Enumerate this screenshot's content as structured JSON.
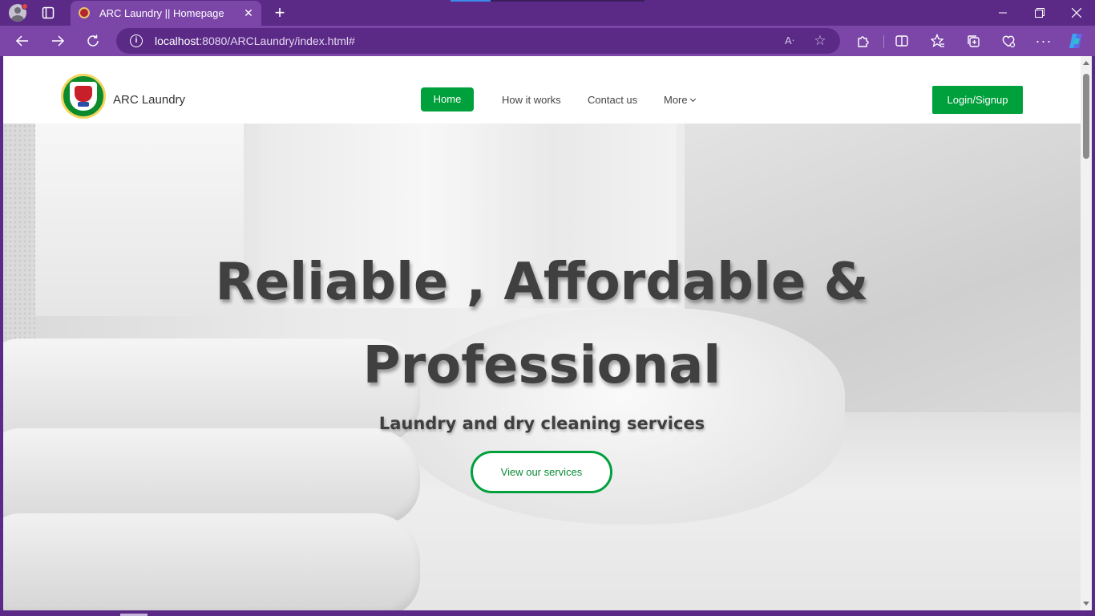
{
  "browser": {
    "tab_title": "ARC Laundry || Homepage",
    "url_host": "localhost",
    "url_path": ":8080/ARCLaundry/index.html#"
  },
  "site": {
    "brand": "ARC Laundry",
    "nav": {
      "home": "Home",
      "how": "How it works",
      "contact": "Contact us",
      "more": "More"
    },
    "login": "Login/Signup"
  },
  "hero": {
    "title_line1": "Reliable , Affordable &",
    "title_line2": "Professional",
    "subtitle": "Laundry and dry cleaning services",
    "cta": "View our services"
  },
  "colors": {
    "browser_frame": "#5b2a86",
    "browser_toolbar": "#7b46a8",
    "accent_green": "#00a03c"
  },
  "icons": [
    "profile-icon",
    "tab-actions-icon",
    "new-tab-icon",
    "back-icon",
    "forward-icon",
    "reload-icon",
    "info-icon",
    "read-aloud-icon",
    "favorite-icon",
    "extensions-icon",
    "split-screen-icon",
    "favorites-bar-icon",
    "collections-icon",
    "browser-essentials-icon",
    "more-icon",
    "copilot-icon",
    "chevron-down-icon"
  ]
}
